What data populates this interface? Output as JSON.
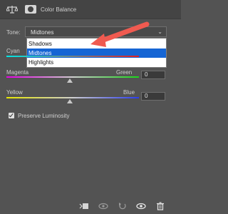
{
  "header": {
    "title": "Color Balance",
    "adjustment_icon": "color-balance-icon",
    "mask_icon": "layer-mask-icon"
  },
  "tone": {
    "label": "Tone:",
    "selected": "Midtones",
    "options": [
      "Shadows",
      "Midtones",
      "Highlights"
    ]
  },
  "sliders": {
    "cyan_red": {
      "left": "Cyan"
    },
    "magenta_green": {
      "left": "Magenta",
      "right": "Green",
      "value": "0"
    },
    "yellow_blue": {
      "left": "Yellow",
      "right": "Blue",
      "value": "0"
    }
  },
  "preserve_luminosity": {
    "label": "Preserve Luminosity",
    "checked": true
  },
  "toolbar": {
    "icons": [
      "clip-to-layer-icon",
      "view-previous-state-icon",
      "reset-icon",
      "visibility-eye-icon",
      "trash-icon"
    ]
  },
  "colors": {
    "panel_bg": "#535353",
    "selection_blue": "#1565d4",
    "annotation_arrow": "#f05a50"
  }
}
